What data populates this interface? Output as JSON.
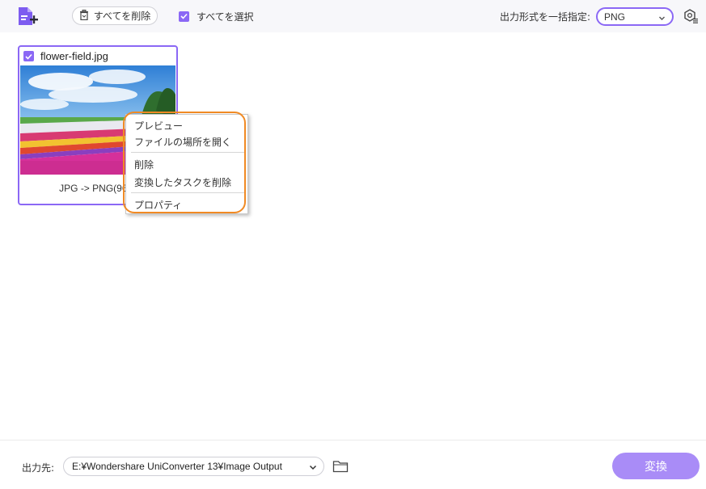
{
  "toolbar": {
    "delete_all_label": "すべてを削除",
    "select_all_label": "すべてを選択",
    "select_all_checked": true,
    "format_label": "出力形式を一括指定:",
    "format_value": "PNG"
  },
  "file_card": {
    "filename": "flower-field.jpg",
    "checked": true,
    "conversion_info": "JPG -> PNG(960*",
    "thumbnail": "flower-field-photo"
  },
  "context_menu": {
    "items": [
      {
        "label": "プレビュー"
      },
      {
        "label": "ファイルの場所を開く"
      },
      {
        "label": "削除"
      },
      {
        "label": "変換したタスクを削除"
      },
      {
        "label": "プロパティ"
      }
    ]
  },
  "footer": {
    "output_label": "出力先:",
    "output_path": "E:¥Wondershare UniConverter 13¥Image Output",
    "convert_label": "変換"
  },
  "colors": {
    "accent": "#8b68f5",
    "convert_button": "#a98cf7",
    "highlight": "#f08a24"
  },
  "icons": [
    "add-file-icon",
    "trash-icon",
    "checkbox-icon",
    "chevron-down-icon",
    "settings-icon",
    "folder-icon"
  ]
}
